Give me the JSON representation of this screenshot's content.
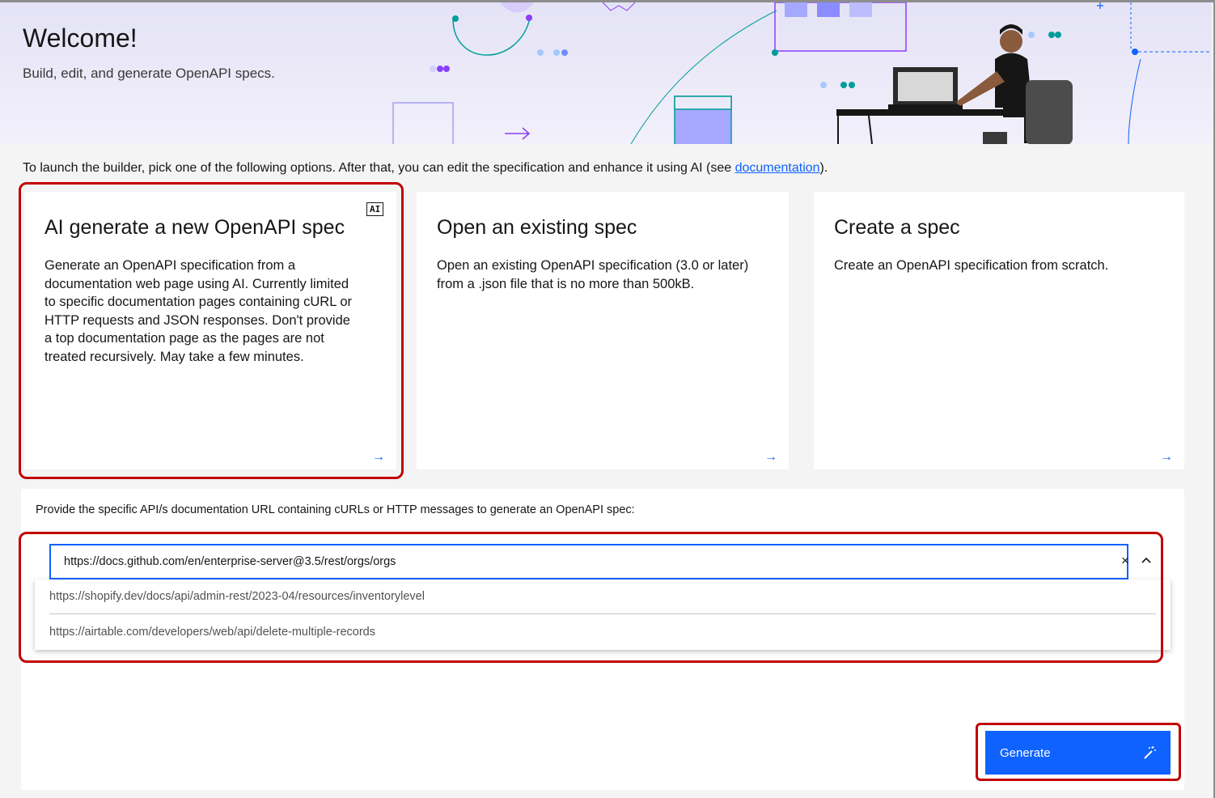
{
  "banner": {
    "title": "Welcome!",
    "subtitle": "Build, edit, and generate OpenAPI specs."
  },
  "intro": {
    "text_before": "To launch the builder, pick one of the following options. After that, you can edit the specification and enhance it using AI (see ",
    "link_label": "documentation",
    "text_after": ")."
  },
  "cards": [
    {
      "title": "AI generate a new OpenAPI spec",
      "badge": "AI",
      "description": "Generate an OpenAPI specification from a documentation web page using AI. Currently limited to specific documentation pages containing cURL or HTTP requests and JSON responses. Don't provide a top documentation page as the pages are not treated recursively. May take a few minutes.",
      "arrow": "→",
      "highlighted": true
    },
    {
      "title": "Open an existing spec",
      "description": "Open an existing OpenAPI specification (3.0 or later) from a .json file that is no more than 500kB.",
      "arrow": "→"
    },
    {
      "title": "Create a spec",
      "description": "Create an OpenAPI specification from scratch.",
      "arrow": "→"
    }
  ],
  "url_form": {
    "prompt": "Provide the specific API/s documentation URL containing cURLs or HTTP messages to generate an OpenAPI spec:",
    "value": "https://docs.github.com/en/enterprise-server@3.5/rest/orgs/orgs",
    "clear_glyph": "×",
    "suggestions": [
      "https://shopify.dev/docs/api/admin-rest/2023-04/resources/inventorylevel",
      "https://airtable.com/developers/web/api/delete-multiple-records"
    ]
  },
  "generate_button": {
    "label": "Generate",
    "icon": "magic-wand-icon"
  },
  "colors": {
    "accent": "#0f62fe",
    "highlight": "#c10000",
    "banner_bg": "#e4e3f6",
    "page_bg": "#f4f4f4"
  }
}
